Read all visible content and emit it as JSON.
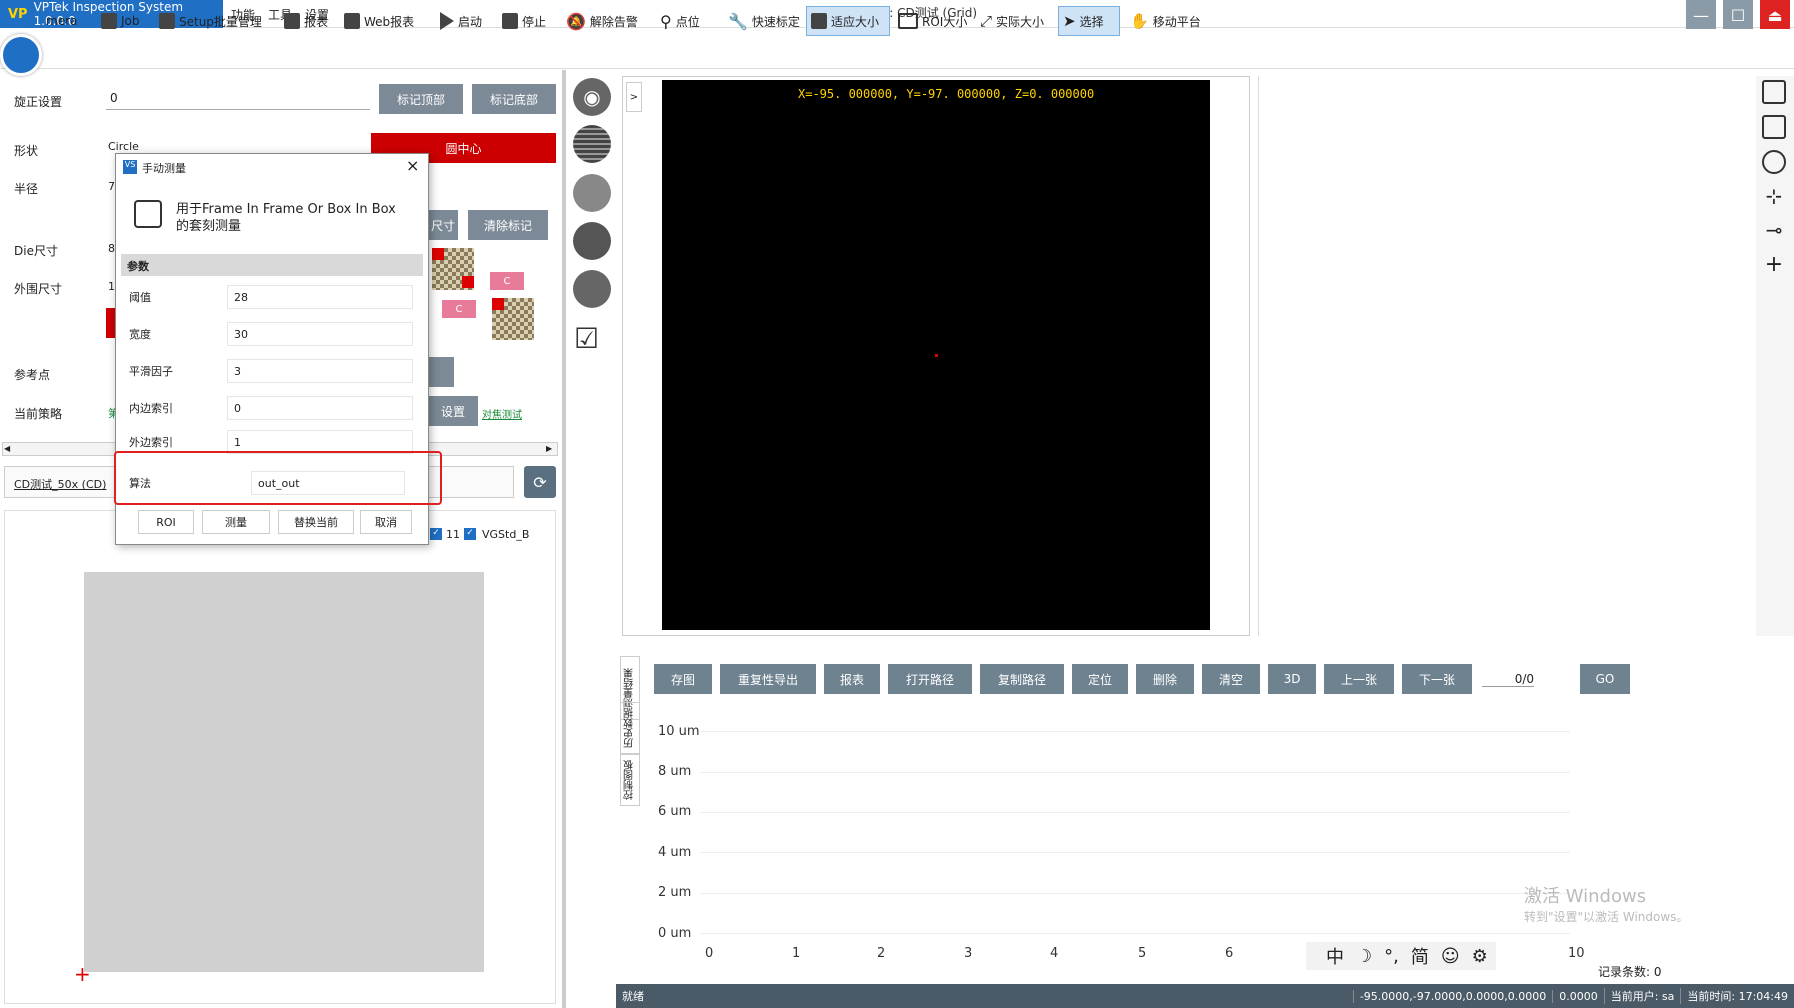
{
  "titlebar": {
    "app_name": "VPTek Inspection System 1.0.0.0",
    "logo": "VP",
    "menus": [
      "功能",
      "工具",
      "设置"
    ],
    "job_title": "当前JOB名称: CD测试 (Grid)"
  },
  "toolbar": {
    "items": [
      "mera",
      "Job",
      "Setup批量管理",
      "报表",
      "Web报表",
      "启动",
      "停止",
      "解除告警",
      "点位",
      "快速标定",
      "适应大小",
      "ROI大小",
      "实际大小",
      "选择",
      "移动平台"
    ]
  },
  "left": {
    "rotate_label": "旋正设置",
    "rotate_value": "0",
    "mark_top": "标记顶部",
    "mark_bottom": "标记底部",
    "shape_label": "形状",
    "shape_value": "Circle",
    "circle_center": "圆中心",
    "radius_label": "半径",
    "radius_value": "7",
    "die_label": "Die尺寸",
    "die_value": "8",
    "outer_label": "外围尺寸",
    "outer_value": "1",
    "ref_label": "参考点",
    "strategy_label": "当前策略",
    "strategy_value": "第",
    "size_btn": "尺寸",
    "clear_mark": "清除标记",
    "setting_btn": "设置",
    "link": "对焦测试",
    "chip_c": "C",
    "job_link": "CD测试_50x (CD)",
    "check_11": "11",
    "check_vg": "VGStd_B"
  },
  "dialog": {
    "title": "手动测量",
    "close": "×",
    "heading_line1": "用于Frame In Frame Or Box In Box",
    "heading_line2": "的套刻测量",
    "section": "参数",
    "params": [
      {
        "label": "阈值",
        "value": "28"
      },
      {
        "label": "宽度",
        "value": "30"
      },
      {
        "label": "平滑因子",
        "value": "3"
      },
      {
        "label": "内边索引",
        "value": "0"
      },
      {
        "label": "外边索引",
        "value": "1"
      }
    ],
    "algo_label": "算法",
    "algo_value": "out_out",
    "buttons": [
      "ROI",
      "测量",
      "替换当前",
      "取消"
    ]
  },
  "viewport": {
    "coords": "X=-95. 000000, Y=-97. 000000, Z=0. 000000",
    "collapse": ">"
  },
  "actions": [
    "存图",
    "重复性导出",
    "报表",
    "打开路径",
    "复制路径",
    "定位",
    "删除",
    "清空",
    "3D",
    "上一张",
    "下一张"
  ],
  "counter": "0/0",
  "go": "GO",
  "vertical_tabs": [
    "测量结果",
    "历史数据",
    "控制图板"
  ],
  "chart_data": {
    "type": "line",
    "y_ticks": [
      "10 um",
      "8 um",
      "6 um",
      "4 um",
      "2 um",
      "0 um"
    ],
    "x_ticks": [
      "0",
      "1",
      "2",
      "3",
      "4",
      "5",
      "6",
      "10"
    ],
    "series": []
  },
  "ime": [
    "中",
    "☽",
    "°,",
    "简",
    "☺",
    "⚙"
  ],
  "record_count": "记录条数: 0",
  "watermark": {
    "line1": "激活 Windows",
    "line2": "转到\"设置\"以激活 Windows。"
  },
  "status": {
    "state": "就绪",
    "position": "-95.0000,-97.0000,0.0000,0.0000",
    "value": "0.0000",
    "user": "当前用户: sa",
    "time": "当前时间: 17:04:49"
  }
}
